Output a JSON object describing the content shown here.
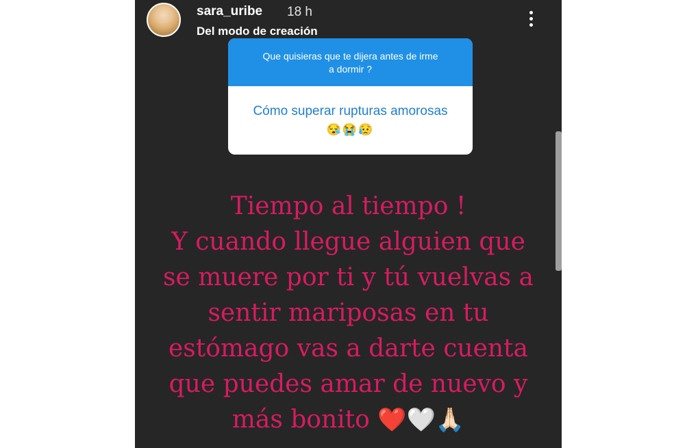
{
  "header": {
    "username": "sara_uribe",
    "time": "18 h",
    "subtitle": "Del modo de creación"
  },
  "question_card": {
    "question_line1": "Que quisieras que te dijera antes de irme",
    "question_line2": "a dormir ?",
    "answer": "Cómo superar rupturas amorosas",
    "answer_emojis": "😪😭😥"
  },
  "story_text": {
    "lines": [
      "Tiempo al tiempo !",
      "Y cuando llegue alguien que",
      "se muere por ti y tú vuelvas a",
      "sentir mariposas en tu",
      "estómago vas a darte cuenta",
      "que puedes amar de nuevo y",
      "más bonito"
    ],
    "emojis": "❤️🤍🙏🏻"
  },
  "icons": {
    "menu": "more-vertical-icon",
    "avatar": "profile-avatar"
  },
  "colors": {
    "background": "#262626",
    "question_header": "#1f90e6",
    "answer_text": "#1f7fd1",
    "story_text": "#d81b60"
  }
}
